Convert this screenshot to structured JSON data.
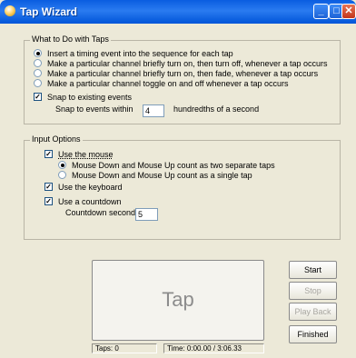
{
  "window": {
    "title": "Tap Wizard"
  },
  "what_to_do": {
    "title": "What to Do with Taps",
    "options": [
      {
        "label": "Insert a timing event into the sequence for each tap",
        "selected": true
      },
      {
        "label": "Make a particular channel briefly turn on, then turn off, whenever a tap occurs",
        "selected": false
      },
      {
        "label": "Make a particular channel briefly turn on, then fade, whenever a tap occurs",
        "selected": false
      },
      {
        "label": "Make a particular channel toggle on and off whenever a tap occurs",
        "selected": false
      }
    ],
    "snap_label": "Snap to existing events",
    "snap_checked": true,
    "snap_within_label": "Snap to events within",
    "snap_value": "4",
    "snap_units": "hundredths of a second"
  },
  "input_options": {
    "title": "Input Options",
    "use_mouse_label": "Use the mouse",
    "use_mouse_checked": true,
    "mouse_options": [
      {
        "label": "Mouse Down and Mouse Up count as two separate taps",
        "selected": true
      },
      {
        "label": "Mouse Down and Mouse Up count as a single tap",
        "selected": false
      }
    ],
    "use_keyboard_label": "Use the keyboard",
    "use_keyboard_checked": true,
    "use_countdown_label": "Use a countdown",
    "use_countdown_checked": true,
    "countdown_label": "Countdown seconds",
    "countdown_value": "5"
  },
  "tap_button": {
    "label": "Tap"
  },
  "buttons": {
    "start": "Start",
    "stop": "Stop",
    "play_back": "Play Back",
    "finished": "Finished"
  },
  "status": {
    "taps": "Taps: 0",
    "time": "Time: 0:00.00 / 3:06.33"
  }
}
